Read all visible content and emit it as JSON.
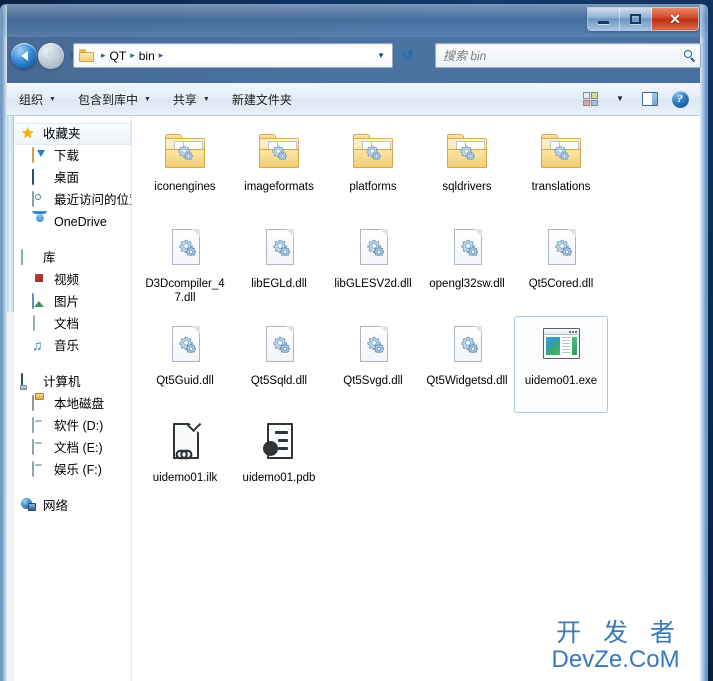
{
  "window": {
    "titlebar": {
      "minimize_label": "–",
      "maximize_label": "□",
      "close_label": "✕"
    }
  },
  "address": {
    "back_tooltip": "后退",
    "forward_tooltip": "前进",
    "breadcrumbs": [
      "QT",
      "bin"
    ],
    "separator": "▸",
    "dropdown_caret": "▼",
    "refresh_label": "↻"
  },
  "search": {
    "placeholder": "搜索 bin",
    "value": ""
  },
  "toolbar": {
    "items": [
      {
        "label": "组织",
        "has_caret": true
      },
      {
        "label": "包含到库中",
        "has_caret": true
      },
      {
        "label": "共享",
        "has_caret": true
      },
      {
        "label": "新建文件夹",
        "has_caret": false
      }
    ],
    "view_caret": "▼",
    "help_label": "?"
  },
  "navpane": {
    "groups": [
      {
        "header": {
          "label": "收藏夹",
          "icon": "star-icon",
          "highlighted": true
        },
        "items": [
          {
            "label": "下载",
            "icon": "download-icon"
          },
          {
            "label": "桌面",
            "icon": "desktop-icon"
          },
          {
            "label": "最近访问的位置",
            "icon": "recent-places-icon"
          },
          {
            "label": "OneDrive",
            "icon": "onedrive-cloud-icon"
          }
        ]
      },
      {
        "header": {
          "label": "库",
          "icon": "library-icon",
          "highlighted": false
        },
        "items": [
          {
            "label": "视频",
            "icon": "video-icon"
          },
          {
            "label": "图片",
            "icon": "picture-icon"
          },
          {
            "label": "文档",
            "icon": "document-icon"
          },
          {
            "label": "音乐",
            "icon": "music-icon"
          }
        ]
      },
      {
        "header": {
          "label": "计算机",
          "icon": "computer-icon",
          "highlighted": false
        },
        "items": [
          {
            "label": "本地磁盘",
            "icon": "hard-disk-icon"
          },
          {
            "label": "软件 (D:)",
            "icon": "drive-icon"
          },
          {
            "label": "文档 (E:)",
            "icon": "drive-icon"
          },
          {
            "label": "娱乐 (F:)",
            "icon": "drive-icon"
          }
        ]
      },
      {
        "header": {
          "label": "网络",
          "icon": "network-icon",
          "highlighted": false
        },
        "items": []
      }
    ]
  },
  "files": [
    {
      "name": "iconengines",
      "kind": "folder",
      "selected": false
    },
    {
      "name": "imageformats",
      "kind": "folder",
      "selected": false
    },
    {
      "name": "platforms",
      "kind": "folder",
      "selected": false
    },
    {
      "name": "sqldrivers",
      "kind": "folder",
      "selected": false
    },
    {
      "name": "translations",
      "kind": "folder",
      "selected": false
    },
    {
      "name": "D3Dcompiler_47.dll",
      "kind": "dll",
      "selected": false
    },
    {
      "name": "libEGLd.dll",
      "kind": "dll",
      "selected": false
    },
    {
      "name": "libGLESV2d.dll",
      "kind": "dll",
      "selected": false
    },
    {
      "name": "opengl32sw.dll",
      "kind": "dll",
      "selected": false
    },
    {
      "name": "Qt5Cored.dll",
      "kind": "dll",
      "selected": false
    },
    {
      "name": "Qt5Guid.dll",
      "kind": "dll",
      "selected": false
    },
    {
      "name": "Qt5Sqld.dll",
      "kind": "dll",
      "selected": false
    },
    {
      "name": "Qt5Svgd.dll",
      "kind": "dll",
      "selected": false
    },
    {
      "name": "Qt5Widgetsd.dll",
      "kind": "dll",
      "selected": false
    },
    {
      "name": "uidemo01.exe",
      "kind": "exe",
      "selected": true
    },
    {
      "name": "uidemo01.ilk",
      "kind": "ilk",
      "selected": false
    },
    {
      "name": "uidemo01.pdb",
      "kind": "pdb",
      "selected": false
    }
  ],
  "watermark": {
    "line1": "开 发 者",
    "line2": "DevZe.CoM",
    "color": "#2a6db5"
  }
}
